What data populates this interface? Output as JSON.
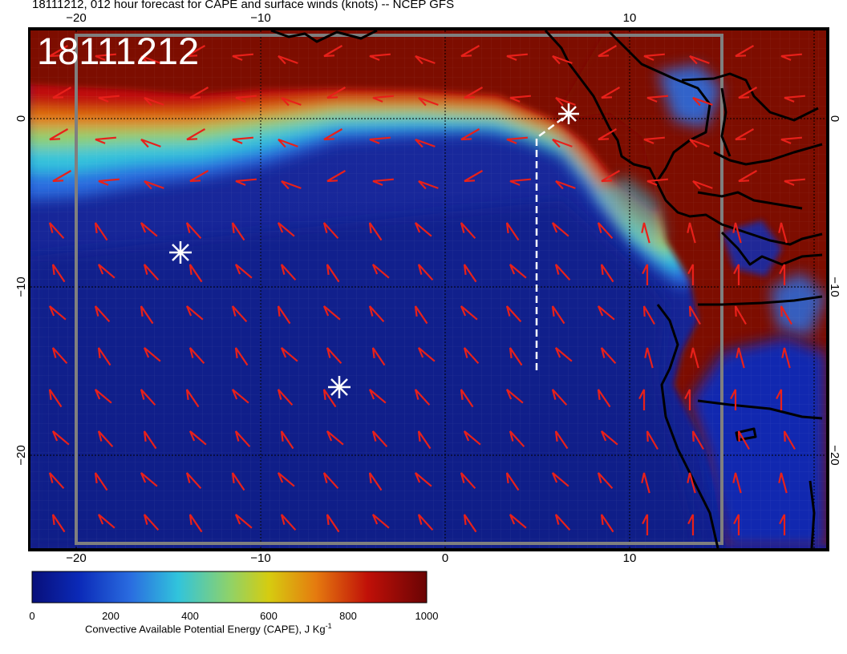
{
  "title": "18111212, 012 hour forecast for CAPE and surface winds (knots) -- NCEP GFS",
  "run_stamp": "18111212",
  "map": {
    "x_ticks": [
      "−20",
      "−10",
      "0",
      "10"
    ],
    "y_ticks": [
      "0",
      "−10",
      "−20"
    ],
    "colors": {
      "wind_barb": "#e8201a",
      "coastline": "#000000",
      "flight_track": "#ffffff",
      "markers": "#ffffff",
      "box_outline": "#7f7f7f",
      "ocean": "#16218f",
      "land_high_cape": "#7d0a04"
    }
  },
  "colorbar": {
    "tick_labels": [
      "0",
      "200",
      "400",
      "600",
      "800",
      "1000"
    ],
    "title_main": "Convective Available Potential Energy (CAPE), J Kg",
    "title_sup": "-1",
    "stops": [
      "#080f7a",
      "#0b2ab8",
      "#2a6de0",
      "#31c4dc",
      "#8ed26a",
      "#d6cc10",
      "#e57a0f",
      "#c01008",
      "#6a0404"
    ]
  },
  "chart_data": {
    "type": "heatmap",
    "title": "18111212, 012 hour forecast for CAPE and surface winds (knots) -- NCEP GFS",
    "xlabel": "",
    "ylabel": "",
    "xlim": [
      -23,
      20
    ],
    "ylim": [
      -25,
      5
    ],
    "x_ticks": [
      -20,
      -10,
      0,
      10
    ],
    "y_ticks": [
      0,
      -10,
      -20
    ],
    "colorbar_range": [
      0,
      1000
    ],
    "colorbar_label": "Convective Available Potential Energy (CAPE), J Kg-1",
    "markers": [
      {
        "symbol": "asterisk",
        "lon": 6.8,
        "lat": 0.3
      },
      {
        "symbol": "asterisk",
        "lon": -14.5,
        "lat": -7.9
      },
      {
        "symbol": "asterisk",
        "lon": -5.8,
        "lat": -15.9
      }
    ],
    "flight_track": [
      [
        5,
        -15
      ],
      [
        5,
        -1.2
      ],
      [
        6.8,
        0.3
      ]
    ],
    "grid": true
  }
}
